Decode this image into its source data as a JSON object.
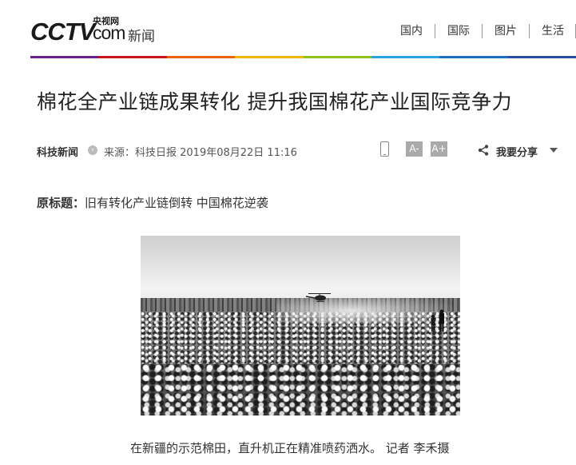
{
  "header": {
    "logo_cctv": "CCTV",
    "logo_yangshi": "央视网",
    "logo_com": "com",
    "logo_section": "新闻",
    "nav": [
      "国内",
      "国际",
      "图片",
      "生活"
    ],
    "color_bar": [
      "#6b1f8c",
      "#c8161d",
      "#e9620f",
      "#f2b705",
      "#8dc21f",
      "#2ba2dd",
      "#1e6fb8",
      "#2a4fa0"
    ]
  },
  "article": {
    "title": "棉花全产业链成果转化 提升我国棉花产业国际竞争力",
    "channel": "科技新闻",
    "source": "来源：科技日报 2019年08月22日 11:16",
    "font_small_label": "A-",
    "font_large_label": "A+",
    "share_label": "我要分享",
    "original_title_label": "原标题：",
    "original_title": "旧有转化产业链倒转 中国棉花逆袭",
    "photo_alt": "",
    "caption": "在新疆的示范棉田，直升机正在精准喷药洒水。 记者 李禾摄"
  }
}
